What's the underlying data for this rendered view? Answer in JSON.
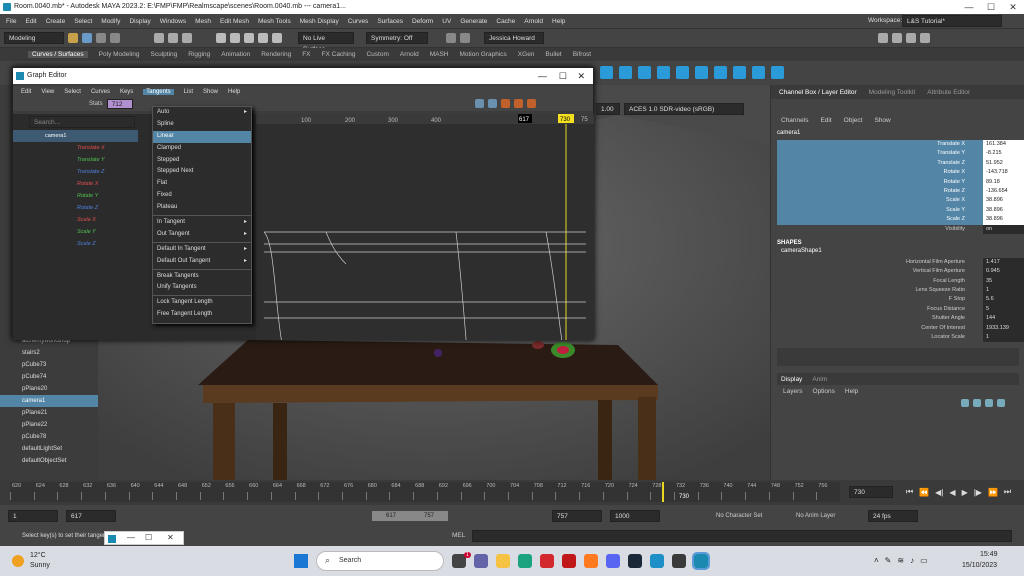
{
  "window": {
    "title": "Room.0040.mb* - Autodesk MAYA 2023.2: E:\\FMP\\FMP\\Realmscape\\scenes\\Room.0040.mb  ---  camera1...",
    "minimize": "—",
    "maximize": "☐",
    "close": "✕"
  },
  "menubar": [
    "File",
    "Edit",
    "Create",
    "Select",
    "Modify",
    "Display",
    "Windows",
    "Mesh",
    "Edit Mesh",
    "Mesh Tools",
    "Mesh Display",
    "Curves",
    "Surfaces",
    "Deform",
    "UV",
    "Generate",
    "Cache",
    "Arnold",
    "Help"
  ],
  "workspace": {
    "label": "Workspace:",
    "value": "L&S Tutorial*"
  },
  "statusline": {
    "mode": "Modeling",
    "live": "No Live Surface",
    "symmetry": "Symmetry: Off",
    "user": "Jessica Howard"
  },
  "shelf_tabs": [
    "Curves / Surfaces",
    "Poly Modeling",
    "Sculpting",
    "Rigging",
    "Animation",
    "Rendering",
    "FX",
    "FX Caching",
    "Custom",
    "Arnold",
    "MASH",
    "Motion Graphics",
    "XGen",
    "Bullet",
    "Bifrost"
  ],
  "graph_editor": {
    "title": "Graph Editor",
    "menu": [
      "Edit",
      "View",
      "Select",
      "Curves",
      "Keys",
      "Tangents",
      "List",
      "Show",
      "Help"
    ],
    "stats_label": "Stats",
    "stats_value": "712",
    "search_placeholder": "Search...",
    "zoom": "1.00",
    "colorspace": "ACES 1.0 SDR-video (sRGB)",
    "ruler": [
      "100",
      "200",
      "300",
      "400",
      "617",
      "730",
      "75"
    ],
    "object": "camera1",
    "channels": [
      {
        "name": "Translate X",
        "color": "#e05050"
      },
      {
        "name": "Translate Y",
        "color": "#50c050"
      },
      {
        "name": "Translate Z",
        "color": "#5080e0"
      },
      {
        "name": "Rotate X",
        "color": "#e05050"
      },
      {
        "name": "Rotate Y",
        "color": "#50c050"
      },
      {
        "name": "Rotate Z",
        "color": "#5080e0"
      },
      {
        "name": "Scale X",
        "color": "#e05050"
      },
      {
        "name": "Scale Y",
        "color": "#50c050"
      },
      {
        "name": "Scale Z",
        "color": "#5080e0"
      }
    ]
  },
  "tangents_menu": [
    {
      "label": "Auto",
      "sub": true
    },
    {
      "label": "Spline"
    },
    {
      "label": "Linear",
      "highlight": true
    },
    {
      "label": "Clamped"
    },
    {
      "label": "Stepped"
    },
    {
      "label": "Stepped Next"
    },
    {
      "label": "Flat"
    },
    {
      "label": "Fixed"
    },
    {
      "label": "Plateau"
    },
    {
      "sep": true
    },
    {
      "label": "In Tangent",
      "sub": true
    },
    {
      "label": "Out Tangent",
      "sub": true
    },
    {
      "sep": true
    },
    {
      "label": "Default In Tangent",
      "sub": true
    },
    {
      "label": "Default Out Tangent",
      "sub": true
    },
    {
      "sep": true
    },
    {
      "label": "Break Tangents"
    },
    {
      "label": "Unify Tangents"
    },
    {
      "sep": true
    },
    {
      "label": "Lock Tangent Length"
    },
    {
      "label": "Free Tangent Length"
    }
  ],
  "outliner_items": [
    {
      "label": "alchemyworkshop"
    },
    {
      "label": "stairs2"
    },
    {
      "label": "pCube73"
    },
    {
      "label": "pCube74"
    },
    {
      "label": "pPlane20"
    },
    {
      "label": "camera1",
      "selected": true
    },
    {
      "label": "pPlane21"
    },
    {
      "label": "pPlane22"
    },
    {
      "label": "pCube78"
    },
    {
      "label": "defaultLightSet"
    },
    {
      "label": "defaultObjectSet"
    }
  ],
  "channel_box": {
    "tabs": [
      "Channel Box / Layer Editor",
      "Modeling Toolkit",
      "Attribute Editor"
    ],
    "menu": [
      "Channels",
      "Edit",
      "Object",
      "Show"
    ],
    "object": "camera1",
    "attributes": [
      {
        "name": "Translate X",
        "value": "161.384"
      },
      {
        "name": "Translate Y",
        "value": "-8.215"
      },
      {
        "name": "Translate Z",
        "value": "51.952"
      },
      {
        "name": "Rotate X",
        "value": "-143.718"
      },
      {
        "name": "Rotate Y",
        "value": "89.18"
      },
      {
        "name": "Rotate Z",
        "value": "-136.654"
      },
      {
        "name": "Scale X",
        "value": "38.896"
      },
      {
        "name": "Scale Y",
        "value": "38.896"
      },
      {
        "name": "Scale Z",
        "value": "38.896"
      },
      {
        "name": "Visibility",
        "value": "on"
      }
    ],
    "shapes_title": "SHAPES",
    "shape_name": "cameraShape1",
    "shape_attrs": [
      {
        "name": "Horizontal Film Aperture",
        "value": "1.417"
      },
      {
        "name": "Vertical Film Aperture",
        "value": "0.945"
      },
      {
        "name": "Focal Length",
        "value": "35"
      },
      {
        "name": "Lens Squeeze Ratio",
        "value": "1"
      },
      {
        "name": "F Stop",
        "value": "5.6"
      },
      {
        "name": "Focus Distance",
        "value": "5"
      },
      {
        "name": "Shutter Angle",
        "value": "144"
      },
      {
        "name": "Center Of Interest",
        "value": "1933.139"
      },
      {
        "name": "Locator Scale",
        "value": "1"
      }
    ],
    "layer_tabs": [
      "Display",
      "Anim"
    ],
    "layer_menu": [
      "Layers",
      "Options",
      "Help"
    ]
  },
  "timeline": {
    "ticks": [
      "620",
      "624",
      "628",
      "632",
      "636",
      "640",
      "644",
      "648",
      "652",
      "656",
      "660",
      "664",
      "668",
      "672",
      "676",
      "680",
      "684",
      "688",
      "692",
      "696",
      "700",
      "704",
      "708",
      "712",
      "716",
      "720",
      "724",
      "728",
      "732",
      "736",
      "740",
      "744",
      "748",
      "752",
      "756"
    ],
    "current": "730",
    "current_frame": "730"
  },
  "range": {
    "start": "1",
    "anim_start": "617",
    "range_start": "617",
    "range_end": "757",
    "anim_end": "757",
    "end": "1000",
    "character": "No Character Set",
    "anim_layer": "No Anim Layer",
    "fps": "24 fps"
  },
  "cmdline": {
    "label": "MEL",
    "help": "Select key(s) to set their tangents."
  },
  "taskbar": {
    "temp": "12°C",
    "weather": "Sunny",
    "search": "Search",
    "time": "15:49",
    "date": "15/10/2023",
    "badge": "1"
  }
}
